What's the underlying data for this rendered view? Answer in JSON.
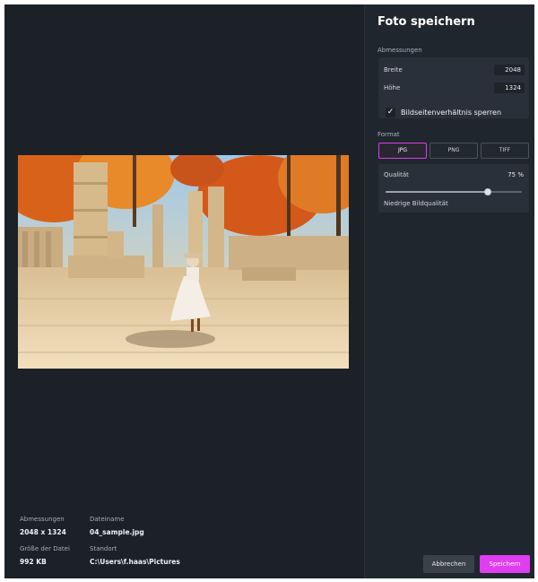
{
  "panel": {
    "title": "Foto speichern",
    "dimensions_section": "Abmessungen",
    "width_label": "Breite",
    "width_value": "2048",
    "height_label": "Höhe",
    "height_value": "1324",
    "lock_aspect_label": "Bildseitenverhältnis sperren",
    "lock_aspect_checked": true,
    "format_section": "Format",
    "formats": [
      "JPG",
      "PNG",
      "TIFF"
    ],
    "selected_format": "JPG",
    "quality_label": "Qualität",
    "quality_value": "75 %",
    "quality_percent": 75,
    "quality_note": "Niedrige Bildqualität",
    "cancel_label": "Abbrechen",
    "save_label": "Speichern"
  },
  "file_info": {
    "dimensions_label": "Abmessungen",
    "dimensions_value": "2048 x 1324",
    "filename_label": "Dateiname",
    "filename_value": "04_sample.jpg",
    "size_label": "Größe der Datei",
    "size_value": "992 KB",
    "location_label": "Standort",
    "location_value": "C:\\Users\\f.haas\\Pictures"
  },
  "colors": {
    "background": "#1c2128",
    "panel": "#20262e",
    "accent": "#e03cf0"
  },
  "icons": {
    "checkbox": "checkmark-icon"
  }
}
